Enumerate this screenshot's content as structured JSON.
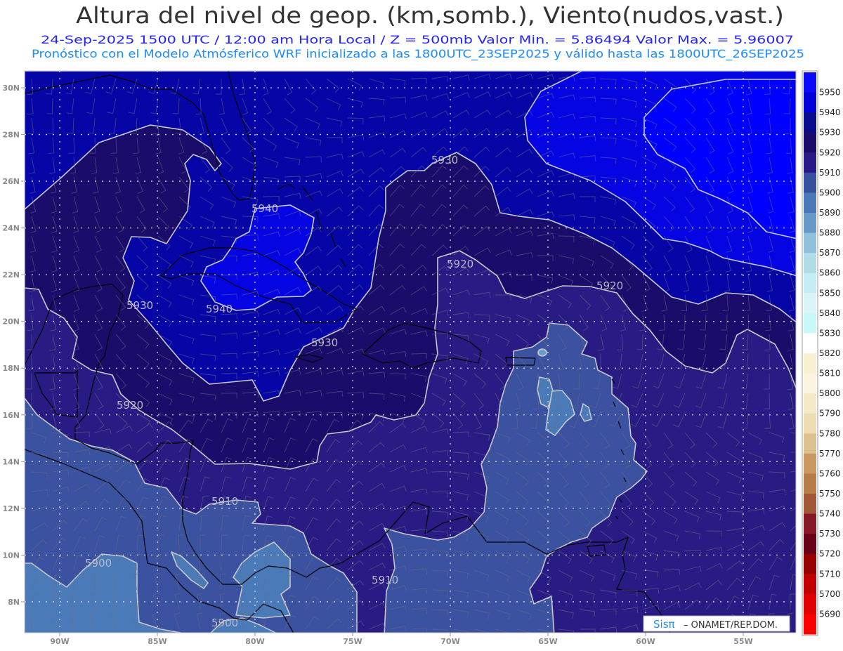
{
  "header": {
    "title": "Altura del nivel de geop. (km,somb.), Viento(nudos,vast.)",
    "subtitle": "24-Sep-2025  1500 UTC / 12:00 am Hora Local / Z = 500mb   Valor Min. = 5.86494  Valor Max. = 5.96007",
    "model_line": "Pronóstico con el Modelo Atmósferico WRF inicializado a las 1800UTC_23SEP2025 y válido hasta las  1800UTC_26SEP2025"
  },
  "axes": {
    "lat_labels": [
      "30N",
      "28N",
      "26N",
      "24N",
      "22N",
      "20N",
      "18N",
      "16N",
      "14N",
      "12N",
      "10N",
      "8N"
    ],
    "lon_labels": [
      "90W",
      "85W",
      "80W",
      "75W",
      "70W",
      "65W",
      "60W",
      "55W"
    ]
  },
  "contour_labels": [
    "5940",
    "5940",
    "5930",
    "5930",
    "5930",
    "5920",
    "5920",
    "5920",
    "5910",
    "5910",
    "5900",
    "5900"
  ],
  "colorbar": {
    "labels": [
      "5950",
      "5940",
      "5930",
      "5920",
      "5910",
      "5900",
      "5890",
      "5880",
      "5870",
      "5860",
      "5850",
      "5840",
      "5830",
      "5820",
      "5810",
      "5800",
      "5790",
      "5780",
      "5770",
      "5760",
      "5750",
      "5740",
      "5730",
      "5720",
      "5710",
      "5700",
      "5690"
    ],
    "colors": [
      "#0a0afa",
      "#0000d8",
      "#0a0a8c",
      "#1a0a6a",
      "#2a1a88",
      "#3850a0",
      "#4a78b8",
      "#6898c8",
      "#90c0dc",
      "#b0dce8",
      "#c4ecf4",
      "#dcf4f8",
      "#c8f8f8",
      "#ffffff",
      "#f8f0d0",
      "#faf4e0",
      "#f4eac8",
      "#eedcb0",
      "#dcc090",
      "#c89860",
      "#b87c48",
      "#a05838",
      "#881828",
      "#680018",
      "#980000",
      "#c00000",
      "#e00000",
      "#ff0000"
    ]
  },
  "fill_colors": {
    "band_5900": "#3a52a0",
    "band_5910": "#281c84",
    "band_5920": "#1a0c6a",
    "band_5930": "#0606a6",
    "band_5940": "#0505e4",
    "band_5950": "#0000ff",
    "band_5890": "#4a7ab8",
    "band_5880": "#6a9ccc"
  },
  "credit": {
    "logo": "Sisπ",
    "text": "– ONAMET/REP.DOM."
  }
}
